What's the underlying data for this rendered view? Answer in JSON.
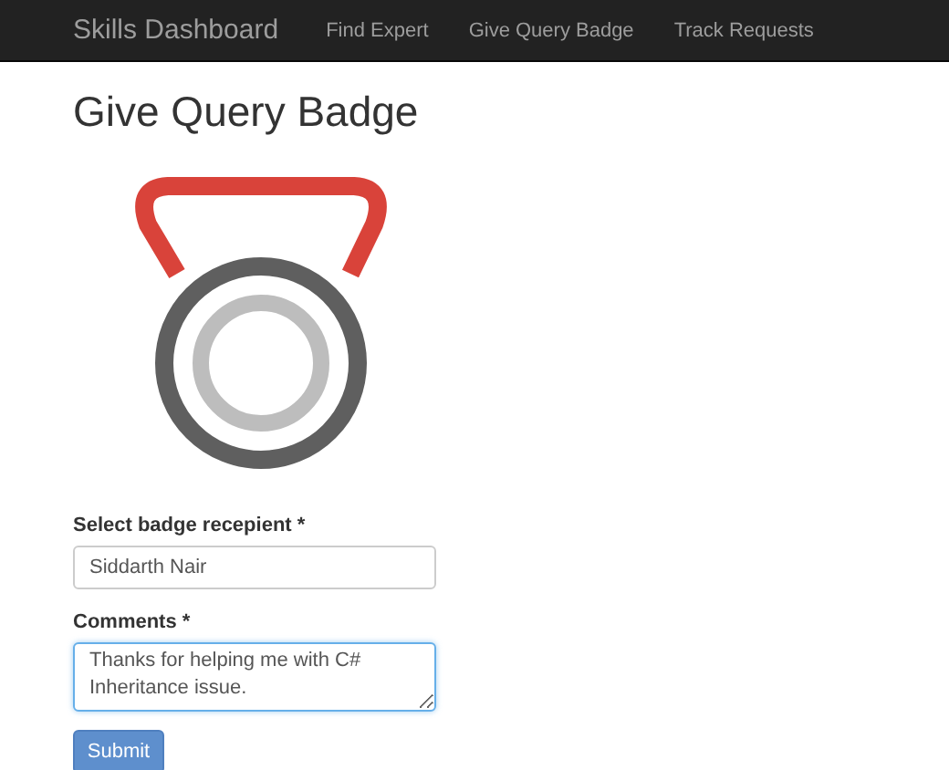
{
  "navbar": {
    "brand": "Skills Dashboard",
    "links": [
      {
        "label": "Find Expert",
        "selected": false
      },
      {
        "label": "Give Query Badge",
        "selected": false
      },
      {
        "label": "Track Requests",
        "selected": false
      }
    ]
  },
  "page_title": "Give Query Badge",
  "form": {
    "fields": [
      {
        "kind": "input",
        "label": "Select badge recepient *",
        "value": "Siddarth Nair"
      },
      {
        "kind": "textarea",
        "label": "Comments *",
        "value": "Thanks for helping me with C# Inheritance issue."
      }
    ],
    "submit": "Submit"
  }
}
